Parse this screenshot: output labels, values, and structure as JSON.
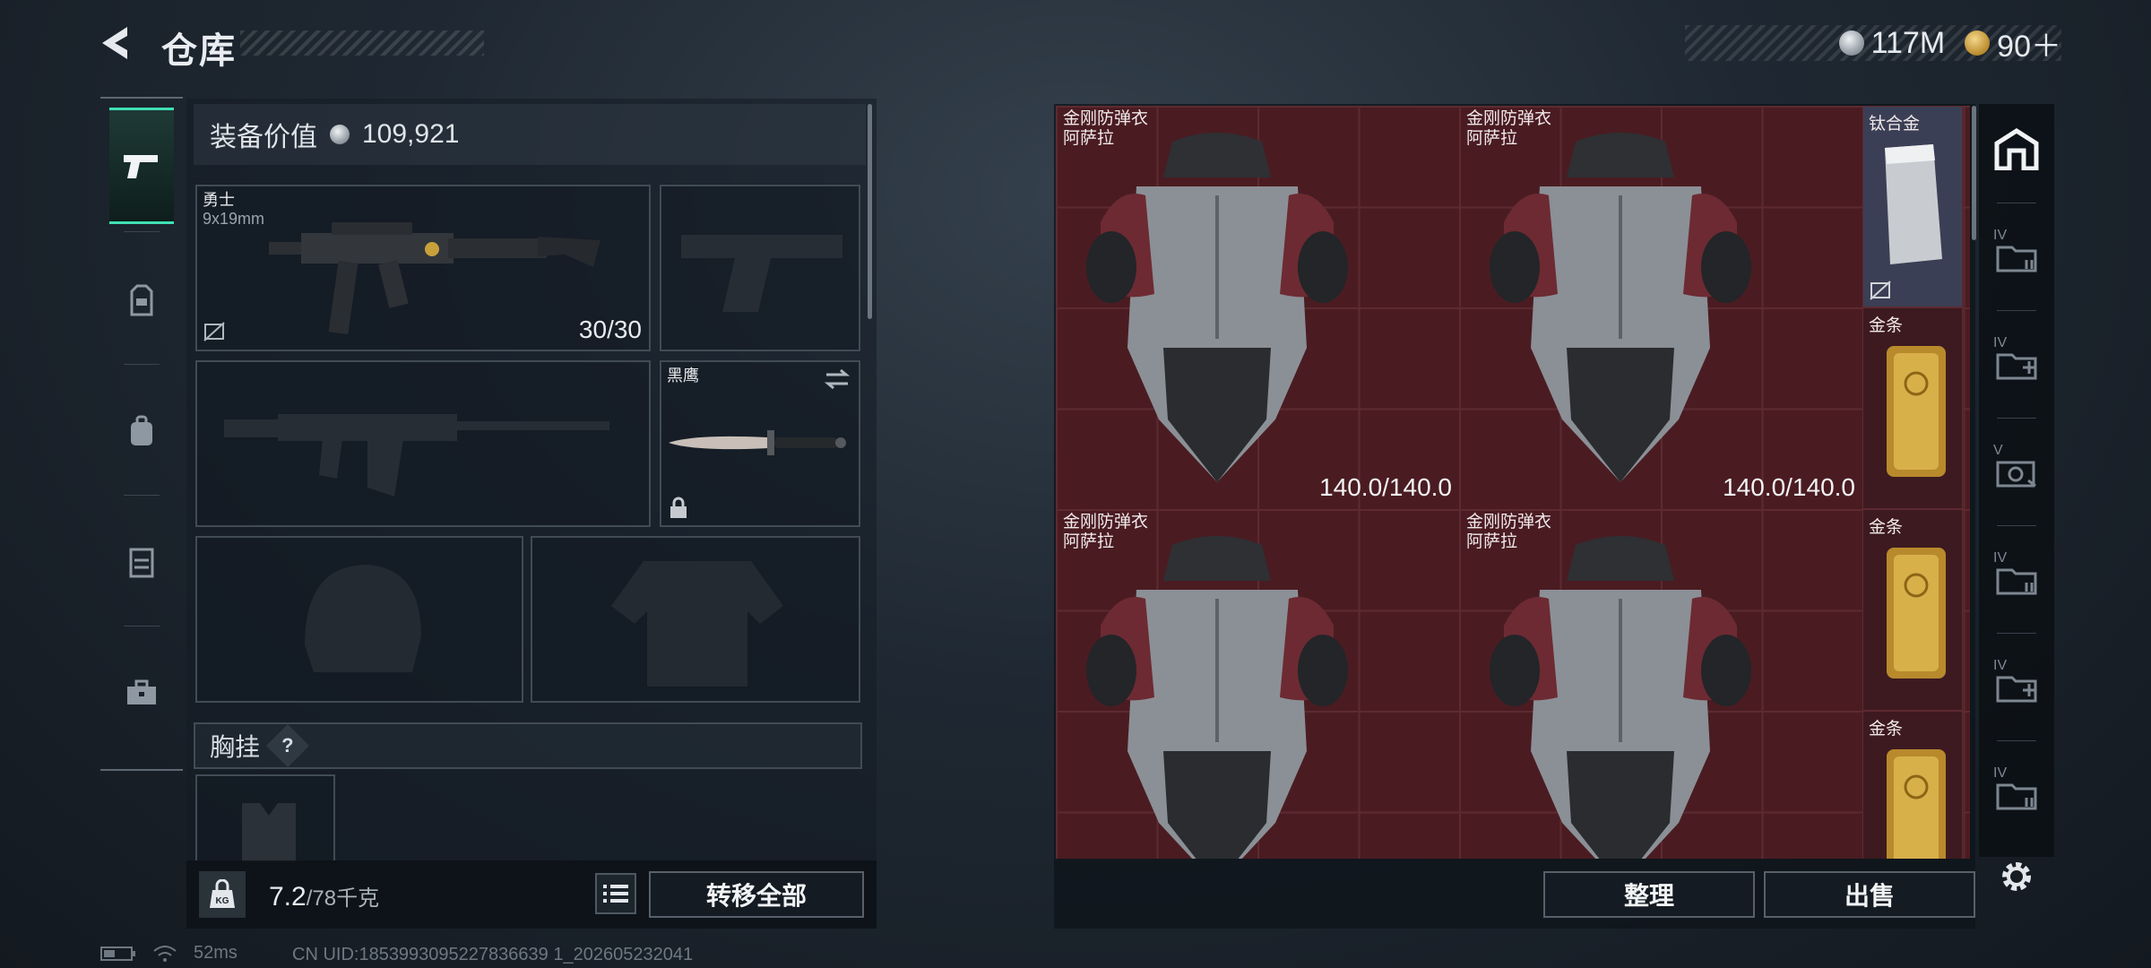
{
  "header": {
    "title": "仓库",
    "currencies": [
      {
        "icon": "silver-coin-icon",
        "value": "117M"
      },
      {
        "icon": "gold-coin-icon",
        "value": "90＋"
      }
    ]
  },
  "left_nav": {
    "items": [
      {
        "icon": "pistol-icon",
        "active": true
      },
      {
        "icon": "helmet-icon",
        "active": false
      },
      {
        "icon": "backpack-icon",
        "active": false
      },
      {
        "icon": "chest-rig-icon",
        "active": false
      },
      {
        "icon": "toolbox-icon",
        "active": false
      }
    ]
  },
  "equipment": {
    "value_label": "装备价值",
    "value": "109,921",
    "primary_weapon": {
      "name": "勇士",
      "caliber": "9x19mm",
      "ammo": "30/30"
    },
    "melee": {
      "name": "黑鹰"
    },
    "chest_rig_label": "胸挂",
    "help_glyph": "?"
  },
  "weight": {
    "current": "7.2",
    "max": "/78千克",
    "icon_text": "KG"
  },
  "buttons": {
    "transfer_all": "转移全部",
    "organize": "整理",
    "sell": "出售"
  },
  "stash": {
    "armors": [
      {
        "name": "金刚防弹衣",
        "sub": "阿萨拉",
        "durability": "140.0/140.0"
      },
      {
        "name": "金刚防弹衣",
        "sub": "阿萨拉",
        "durability": "140.0/140.0"
      },
      {
        "name": "金刚防弹衣",
        "sub": "阿萨拉",
        "durability": ""
      },
      {
        "name": "金刚防弹衣",
        "sub": "阿萨拉",
        "durability": ""
      }
    ],
    "side_items": [
      {
        "name": "钛合金"
      },
      {
        "name": "金条"
      },
      {
        "name": "金条"
      },
      {
        "name": "金条"
      }
    ]
  },
  "right_nav": {
    "items": [
      {
        "icon": "home-stash-icon",
        "label": ""
      },
      {
        "icon": "storage-case-icon",
        "label": "IV"
      },
      {
        "icon": "medical-case-icon",
        "label": "IV"
      },
      {
        "icon": "tool-case-icon",
        "label": "V"
      },
      {
        "icon": "storage-case-icon",
        "label": "IV"
      },
      {
        "icon": "medical-case-icon",
        "label": "IV"
      },
      {
        "icon": "storage-case-icon",
        "label": "IV"
      }
    ]
  },
  "status": {
    "ping": "52ms",
    "uid": "CN UID:1853993095227836639 1_202605232041"
  },
  "colors": {
    "accent": "#3ee0b4",
    "stash_bg": "#4a1c22",
    "gold": "#c9a13a"
  }
}
